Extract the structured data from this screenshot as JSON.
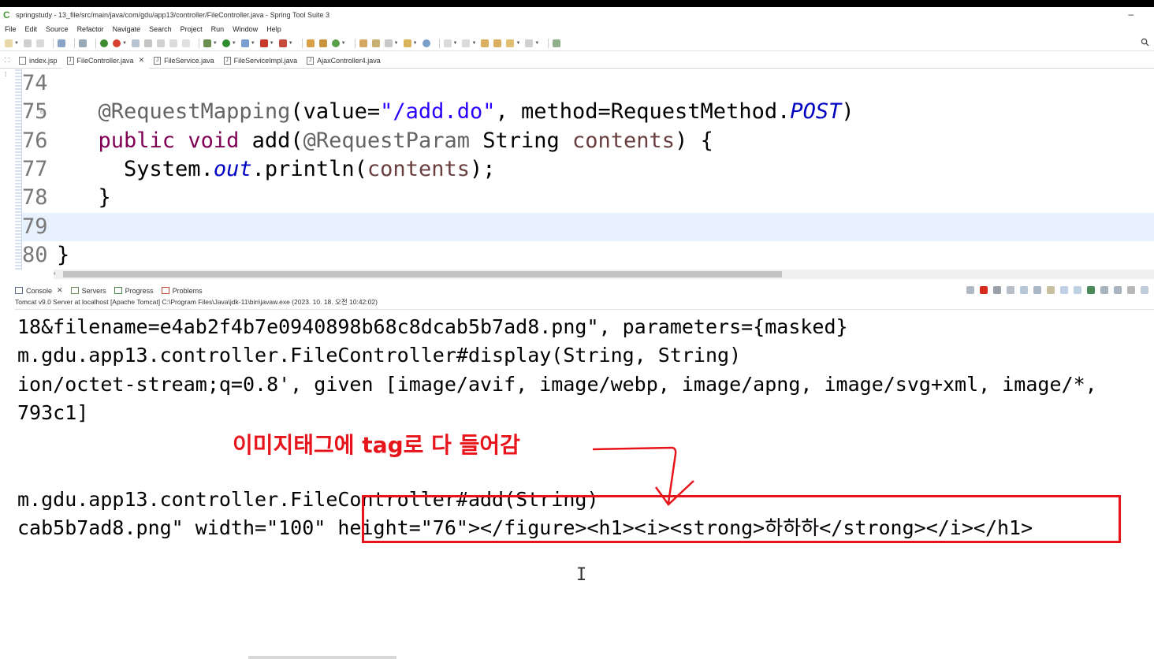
{
  "window": {
    "title": "springstudy - 13_file/src/main/java/com/gdu/app13/controller/FileController.java - Spring Tool Suite 3",
    "minimize_glyph": "–"
  },
  "menu": [
    "File",
    "Edit",
    "Source",
    "Refactor",
    "Navigate",
    "Search",
    "Project",
    "Run",
    "Window",
    "Help"
  ],
  "editor_tabs": [
    {
      "label": "index.jsp",
      "active": false
    },
    {
      "label": "FileController.java",
      "active": true
    },
    {
      "label": "FileService.java",
      "active": false
    },
    {
      "label": "FileServiceImpl.java",
      "active": false
    },
    {
      "label": "AjaxController4.java",
      "active": false
    }
  ],
  "code": {
    "lines": [
      {
        "num": "74"
      },
      {
        "num": "75",
        "a1": "@RequestMapping",
        "p1": "(value=",
        "s1": "\"/add.do\"",
        "p2": ", method=RequestMethod.",
        "f1": "POST",
        "p3": ")"
      },
      {
        "num": "76",
        "k1": "public",
        "k2": "void",
        "p1": " add(",
        "a1": "@RequestParam",
        "p2": " String ",
        "v1": "contents",
        "p3": ") {"
      },
      {
        "num": "77",
        "p1": "System.",
        "f1": "out",
        "p2": ".println(",
        "v1": "contents",
        "p3": ");"
      },
      {
        "num": "78",
        "p1": "}"
      },
      {
        "num": "79"
      },
      {
        "num": "80",
        "p1": "}"
      }
    ]
  },
  "console": {
    "tabs": [
      {
        "label": "Console",
        "closable": true
      },
      {
        "label": "Servers",
        "closable": false
      },
      {
        "label": "Progress",
        "closable": false
      },
      {
        "label": "Problems",
        "closable": false
      }
    ],
    "description": "Tomcat v9.0 Server at localhost [Apache Tomcat] C:\\Program Files\\Java\\jdk-11\\bin\\javaw.exe  (2023. 10. 18. 오전 10:42:02)",
    "output": [
      "18&filename=e4ab2f4b7e0940898b68c8dcab5b7ad8.png\", parameters={masked}",
      "m.gdu.app13.controller.FileController#display(String, String)",
      "ion/octet-stream;q=0.8', given [image/avif, image/webp, image/apng, image/svg+xml, image/*,",
      "793c1]",
      "",
      "",
      "m.gdu.app13.controller.FileController#add(String)",
      "cab5b7ad8.png\" width=\"100\" height=\"76\"></figure><h1><i><strong>하하하</strong></i></h1>"
    ]
  },
  "annotation": {
    "text": "이미지태그에 tag로 다 들어감",
    "color": "#e8141b"
  },
  "cursor_glyph": "I"
}
